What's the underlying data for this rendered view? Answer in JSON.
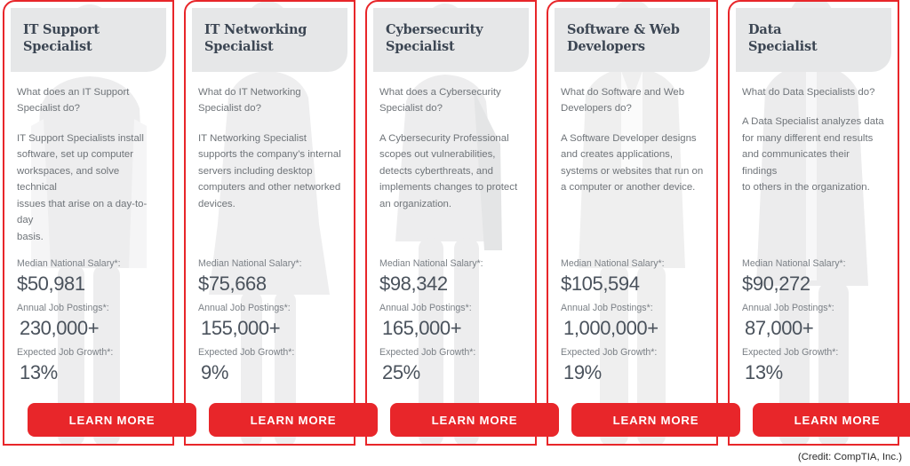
{
  "credit": "(Credit: CompTIA, Inc.)",
  "labels": {
    "salary": "Median National Salary*:",
    "postings": "Annual Job Postings*:",
    "growth": "Expected Job Growth*:",
    "cta": "LEARN MORE"
  },
  "colors": {
    "accent_red": "#e8262a",
    "header_gray": "#e6e7e8",
    "title_text": "#3c4653",
    "body_text": "#6f7479",
    "value_text": "#4a525c",
    "page_background": "#ffffff"
  },
  "cards": [
    {
      "title": "IT Support\nSpecialist",
      "question": "What does an IT Support\nSpecialist do?",
      "description": "IT Support Specialists install\nsoftware, set up computer\nworkspaces, and solve technical\nissues that arise on a day-to-day\nbasis.",
      "salary": "$50,981",
      "postings": "230,000+",
      "growth": "13%",
      "cta": "LEARN MORE"
    },
    {
      "title": "IT Networking\nSpecialist",
      "question": "What do IT Networking\nSpecialist do?",
      "description": "IT Networking Specialist\nsupports the company’s internal\nservers including desktop\ncomputers and other networked\ndevices.",
      "salary": "$75,668",
      "postings": "155,000+",
      "growth": "9%",
      "cta": "LEARN MORE"
    },
    {
      "title": "Cybersecurity\nSpecialist",
      "question": "What does a Cybersecurity\nSpecialist do?",
      "description": "A Cybersecurity Professional\nscopes out vulnerabilities,\ndetects cyberthreats, and\nimplements changes to protect\nan organization.",
      "salary": "$98,342",
      "postings": "165,000+",
      "growth": "25%",
      "cta": "LEARN MORE"
    },
    {
      "title": "Software & Web\nDevelopers",
      "question": "What do Software and Web\nDevelopers do?",
      "description": "A Software Developer designs\nand creates applications,\nsystems or websites that run on\na computer or another device.",
      "salary": "$105,594",
      "postings": "1,000,000+",
      "growth": "19%",
      "cta": "LEARN MORE"
    },
    {
      "title": "Data\nSpecialist",
      "question": "What do Data Specialists do?",
      "description": "A Data Specialist analyzes data\nfor many different end results\nand communicates their findings\nto others in the organization.",
      "salary": "$90,272",
      "postings": "87,000+",
      "growth": "13%",
      "cta": "LEARN MORE"
    }
  ]
}
